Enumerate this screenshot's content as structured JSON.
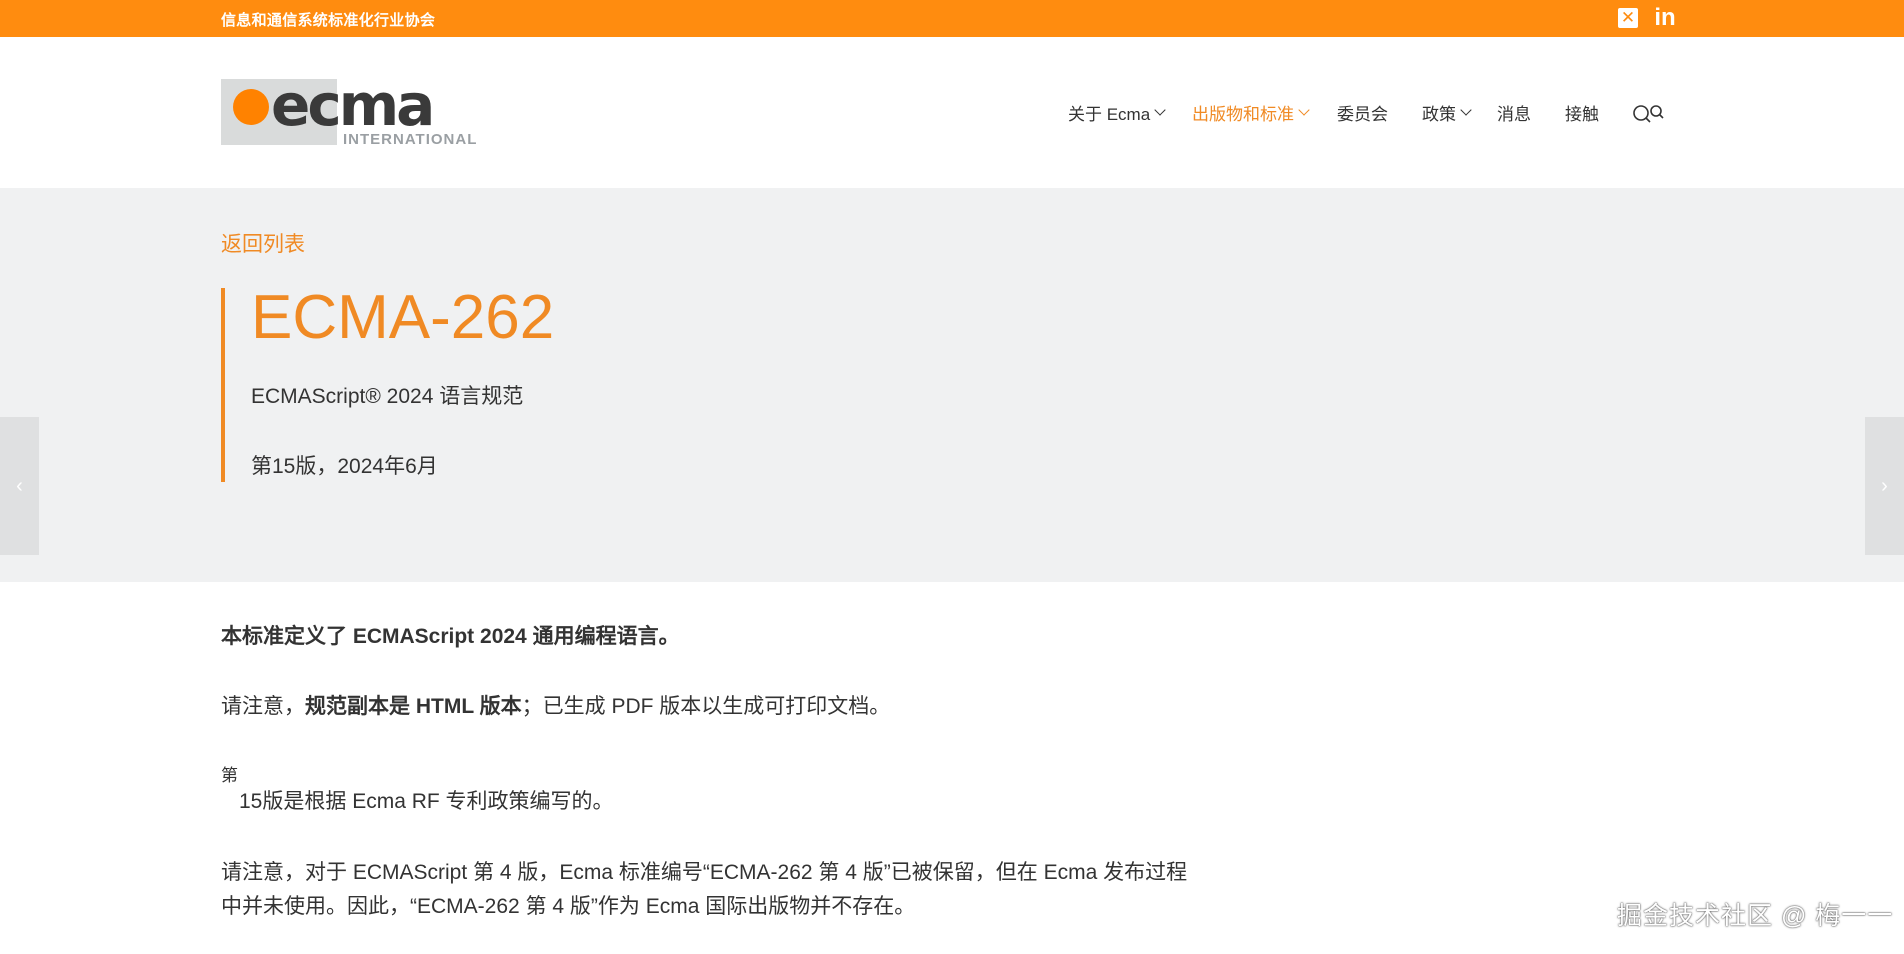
{
  "topbar": {
    "org_name": "信息和通信系统标准化行业协会",
    "social": [
      "x-icon",
      "linkedin-icon"
    ],
    "x_glyph": "✕",
    "linkedin_glyph": "in"
  },
  "colors": {
    "topbar": "#ff8c0f",
    "accent": "#f08a24",
    "hero_bg": "#f0f1f2",
    "text": "#333333"
  },
  "logo": {
    "word": "ecma",
    "sub": "INTERNATIONAL"
  },
  "nav": {
    "items": [
      {
        "label": "关于 Ecma",
        "has_dropdown": true,
        "active": false
      },
      {
        "label": "出版物和标准",
        "has_dropdown": true,
        "active": true
      },
      {
        "label": "委员会",
        "has_dropdown": false,
        "active": false
      },
      {
        "label": "政策",
        "has_dropdown": true,
        "active": false
      },
      {
        "label": "消息",
        "has_dropdown": false,
        "active": false
      },
      {
        "label": "接触",
        "has_dropdown": false,
        "active": false
      }
    ],
    "search_icon": "search-icon"
  },
  "hero": {
    "back_label": "返回列表",
    "title": "ECMA-262",
    "subtitle": "ECMAScript® 2024 语言规范",
    "edition": "第15版，2024年6月",
    "prev_arrow": "‹",
    "next_arrow": "›"
  },
  "content": {
    "p1": "本标准定义了 ECMAScript 2024 通用编程语言。",
    "p2_prefix": "请注意，",
    "p2_bold": "规范副本是 HTML 版本",
    "p2_suffix": "；已生成 PDF 版本以生成可打印文档。",
    "p3_sup": "第",
    "p3": "15版是根据 Ecma RF 专利政策编写的。",
    "p4": "请注意，对于 ECMAScript 第 4 版，Ecma 标准编号“ECMA-262 第 4 版”已被保留，但在 Ecma 发布过程中并未使用。因此，“ECMA-262 第 4 版”作为 Ecma 国际出版物并不存在。"
  },
  "watermark": "掘金技术社区 @ 梅一一"
}
